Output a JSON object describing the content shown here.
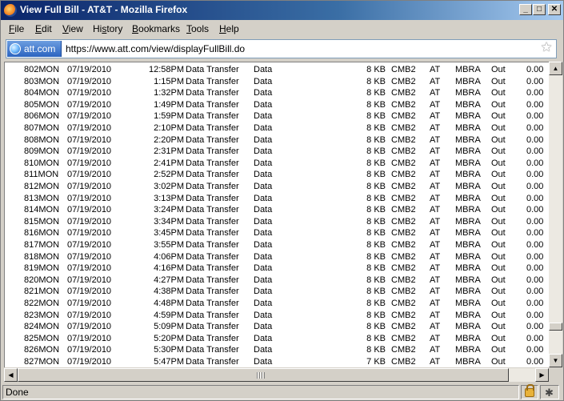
{
  "window": {
    "title": "View Full Bill - AT&T - Mozilla Firefox"
  },
  "menu": [
    {
      "label": "File",
      "ul": "F",
      "rest": "ile"
    },
    {
      "label": "Edit",
      "ul": "E",
      "rest": "dit"
    },
    {
      "label": "View",
      "ul": "V",
      "rest": "iew"
    },
    {
      "label": "History",
      "ul": "s",
      "pre": "Hi",
      "rest": "tory"
    },
    {
      "label": "Bookmarks",
      "ul": "B",
      "rest": "ookmarks"
    },
    {
      "label": "Tools",
      "ul": "T",
      "rest": "ools"
    },
    {
      "label": "Help",
      "ul": "H",
      "rest": "elp"
    }
  ],
  "urlbar": {
    "site": "att.com",
    "url": "https://www.att.com/view/displayFullBill.do"
  },
  "rows": [
    {
      "num": "802",
      "day": "MON",
      "date": "07/19/2010",
      "time": "12:58PM",
      "desc": "Data Transfer",
      "type": "Data",
      "size": "8 KB",
      "plan": "CMB2",
      "net": "AT",
      "feature": "MBRA",
      "dir": "Out",
      "cost": "0.00"
    },
    {
      "num": "803",
      "day": "MON",
      "date": "07/19/2010",
      "time": "1:15PM",
      "desc": "Data Transfer",
      "type": "Data",
      "size": "8 KB",
      "plan": "CMB2",
      "net": "AT",
      "feature": "MBRA",
      "dir": "Out",
      "cost": "0.00"
    },
    {
      "num": "804",
      "day": "MON",
      "date": "07/19/2010",
      "time": "1:32PM",
      "desc": "Data Transfer",
      "type": "Data",
      "size": "8 KB",
      "plan": "CMB2",
      "net": "AT",
      "feature": "MBRA",
      "dir": "Out",
      "cost": "0.00"
    },
    {
      "num": "805",
      "day": "MON",
      "date": "07/19/2010",
      "time": "1:49PM",
      "desc": "Data Transfer",
      "type": "Data",
      "size": "8 KB",
      "plan": "CMB2",
      "net": "AT",
      "feature": "MBRA",
      "dir": "Out",
      "cost": "0.00"
    },
    {
      "num": "806",
      "day": "MON",
      "date": "07/19/2010",
      "time": "1:59PM",
      "desc": "Data Transfer",
      "type": "Data",
      "size": "8 KB",
      "plan": "CMB2",
      "net": "AT",
      "feature": "MBRA",
      "dir": "Out",
      "cost": "0.00"
    },
    {
      "num": "807",
      "day": "MON",
      "date": "07/19/2010",
      "time": "2:10PM",
      "desc": "Data Transfer",
      "type": "Data",
      "size": "8 KB",
      "plan": "CMB2",
      "net": "AT",
      "feature": "MBRA",
      "dir": "Out",
      "cost": "0.00"
    },
    {
      "num": "808",
      "day": "MON",
      "date": "07/19/2010",
      "time": "2:20PM",
      "desc": "Data Transfer",
      "type": "Data",
      "size": "8 KB",
      "plan": "CMB2",
      "net": "AT",
      "feature": "MBRA",
      "dir": "Out",
      "cost": "0.00"
    },
    {
      "num": "809",
      "day": "MON",
      "date": "07/19/2010",
      "time": "2:31PM",
      "desc": "Data Transfer",
      "type": "Data",
      "size": "8 KB",
      "plan": "CMB2",
      "net": "AT",
      "feature": "MBRA",
      "dir": "Out",
      "cost": "0.00"
    },
    {
      "num": "810",
      "day": "MON",
      "date": "07/19/2010",
      "time": "2:41PM",
      "desc": "Data Transfer",
      "type": "Data",
      "size": "8 KB",
      "plan": "CMB2",
      "net": "AT",
      "feature": "MBRA",
      "dir": "Out",
      "cost": "0.00"
    },
    {
      "num": "811",
      "day": "MON",
      "date": "07/19/2010",
      "time": "2:52PM",
      "desc": "Data Transfer",
      "type": "Data",
      "size": "8 KB",
      "plan": "CMB2",
      "net": "AT",
      "feature": "MBRA",
      "dir": "Out",
      "cost": "0.00"
    },
    {
      "num": "812",
      "day": "MON",
      "date": "07/19/2010",
      "time": "3:02PM",
      "desc": "Data Transfer",
      "type": "Data",
      "size": "8 KB",
      "plan": "CMB2",
      "net": "AT",
      "feature": "MBRA",
      "dir": "Out",
      "cost": "0.00"
    },
    {
      "num": "813",
      "day": "MON",
      "date": "07/19/2010",
      "time": "3:13PM",
      "desc": "Data Transfer",
      "type": "Data",
      "size": "8 KB",
      "plan": "CMB2",
      "net": "AT",
      "feature": "MBRA",
      "dir": "Out",
      "cost": "0.00"
    },
    {
      "num": "814",
      "day": "MON",
      "date": "07/19/2010",
      "time": "3:24PM",
      "desc": "Data Transfer",
      "type": "Data",
      "size": "8 KB",
      "plan": "CMB2",
      "net": "AT",
      "feature": "MBRA",
      "dir": "Out",
      "cost": "0.00"
    },
    {
      "num": "815",
      "day": "MON",
      "date": "07/19/2010",
      "time": "3:34PM",
      "desc": "Data Transfer",
      "type": "Data",
      "size": "8 KB",
      "plan": "CMB2",
      "net": "AT",
      "feature": "MBRA",
      "dir": "Out",
      "cost": "0.00"
    },
    {
      "num": "816",
      "day": "MON",
      "date": "07/19/2010",
      "time": "3:45PM",
      "desc": "Data Transfer",
      "type": "Data",
      "size": "8 KB",
      "plan": "CMB2",
      "net": "AT",
      "feature": "MBRA",
      "dir": "Out",
      "cost": "0.00"
    },
    {
      "num": "817",
      "day": "MON",
      "date": "07/19/2010",
      "time": "3:55PM",
      "desc": "Data Transfer",
      "type": "Data",
      "size": "8 KB",
      "plan": "CMB2",
      "net": "AT",
      "feature": "MBRA",
      "dir": "Out",
      "cost": "0.00"
    },
    {
      "num": "818",
      "day": "MON",
      "date": "07/19/2010",
      "time": "4:06PM",
      "desc": "Data Transfer",
      "type": "Data",
      "size": "8 KB",
      "plan": "CMB2",
      "net": "AT",
      "feature": "MBRA",
      "dir": "Out",
      "cost": "0.00"
    },
    {
      "num": "819",
      "day": "MON",
      "date": "07/19/2010",
      "time": "4:16PM",
      "desc": "Data Transfer",
      "type": "Data",
      "size": "8 KB",
      "plan": "CMB2",
      "net": "AT",
      "feature": "MBRA",
      "dir": "Out",
      "cost": "0.00"
    },
    {
      "num": "820",
      "day": "MON",
      "date": "07/19/2010",
      "time": "4:27PM",
      "desc": "Data Transfer",
      "type": "Data",
      "size": "8 KB",
      "plan": "CMB2",
      "net": "AT",
      "feature": "MBRA",
      "dir": "Out",
      "cost": "0.00"
    },
    {
      "num": "821",
      "day": "MON",
      "date": "07/19/2010",
      "time": "4:38PM",
      "desc": "Data Transfer",
      "type": "Data",
      "size": "8 KB",
      "plan": "CMB2",
      "net": "AT",
      "feature": "MBRA",
      "dir": "Out",
      "cost": "0.00"
    },
    {
      "num": "822",
      "day": "MON",
      "date": "07/19/2010",
      "time": "4:48PM",
      "desc": "Data Transfer",
      "type": "Data",
      "size": "8 KB",
      "plan": "CMB2",
      "net": "AT",
      "feature": "MBRA",
      "dir": "Out",
      "cost": "0.00"
    },
    {
      "num": "823",
      "day": "MON",
      "date": "07/19/2010",
      "time": "4:59PM",
      "desc": "Data Transfer",
      "type": "Data",
      "size": "8 KB",
      "plan": "CMB2",
      "net": "AT",
      "feature": "MBRA",
      "dir": "Out",
      "cost": "0.00"
    },
    {
      "num": "824",
      "day": "MON",
      "date": "07/19/2010",
      "time": "5:09PM",
      "desc": "Data Transfer",
      "type": "Data",
      "size": "8 KB",
      "plan": "CMB2",
      "net": "AT",
      "feature": "MBRA",
      "dir": "Out",
      "cost": "0.00"
    },
    {
      "num": "825",
      "day": "MON",
      "date": "07/19/2010",
      "time": "5:20PM",
      "desc": "Data Transfer",
      "type": "Data",
      "size": "8 KB",
      "plan": "CMB2",
      "net": "AT",
      "feature": "MBRA",
      "dir": "Out",
      "cost": "0.00"
    },
    {
      "num": "826",
      "day": "MON",
      "date": "07/19/2010",
      "time": "5:30PM",
      "desc": "Data Transfer",
      "type": "Data",
      "size": "8 KB",
      "plan": "CMB2",
      "net": "AT",
      "feature": "MBRA",
      "dir": "Out",
      "cost": "0.00"
    },
    {
      "num": "827",
      "day": "MON",
      "date": "07/19/2010",
      "time": "5:47PM",
      "desc": "Data Transfer",
      "type": "Data",
      "size": "7 KB",
      "plan": "CMB2",
      "net": "AT",
      "feature": "MBRA",
      "dir": "Out",
      "cost": "0.00"
    }
  ],
  "status": {
    "text": "Done"
  },
  "icons": {
    "app": "firefox-icon",
    "globe": "globe-icon",
    "bookmark": "star-icon",
    "secure": "lock-icon",
    "debug": "bug-icon"
  }
}
